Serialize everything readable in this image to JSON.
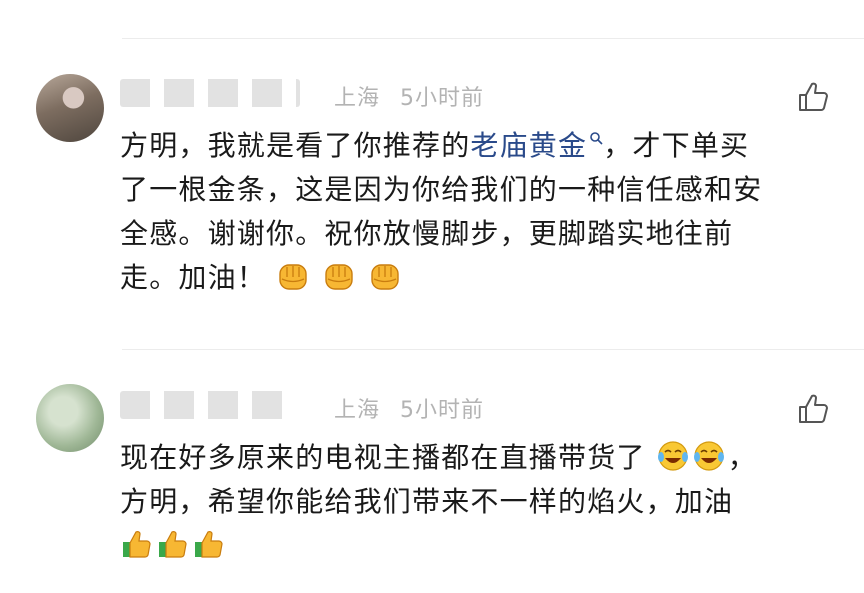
{
  "comments": [
    {
      "location": "上海",
      "time": "5小时前",
      "text_before_link": "方明，我就是看了你推荐的",
      "link_text": "老庙黄金",
      "text_line_1_rest": "，才下单买",
      "text_line_2": "了一根金条，这是因为你给我们的一种信任感和安",
      "text_line_3": "全感。谢谢你。祝你放慢脚步，更脚踏实地往前",
      "text_line_4": "走。加油！",
      "emoji": [
        "fist-emoji",
        "fist-emoji",
        "fist-emoji"
      ]
    },
    {
      "location": "上海",
      "time": "5小时前",
      "text_line_1": "现在好多原来的电视主播都在直播带货了",
      "text_line_1_end": "，",
      "text_line_2": "方明，希望你能给我们带来不一样的焰火，加油",
      "emoji_line_1": [
        "laughing-tears-emoji",
        "laughing-tears-emoji"
      ],
      "emoji_line_3": [
        "thumbs-up-emoji",
        "thumbs-up-emoji",
        "thumbs-up-emoji"
      ]
    }
  ],
  "colors": {
    "link": "#2a4a8a",
    "meta": "#b3b3b3",
    "text": "#1a1a1a",
    "divider": "#ececec"
  }
}
